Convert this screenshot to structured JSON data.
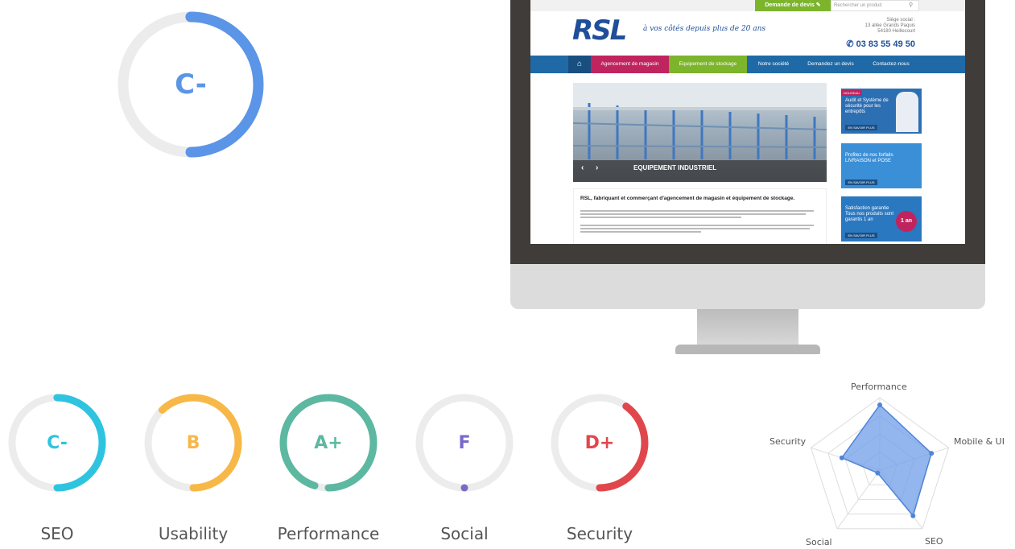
{
  "main_gauge": {
    "grade": "C-",
    "value": 0.5,
    "color": "#5b95e8"
  },
  "gauges": [
    {
      "label": "SEO",
      "grade": "C-",
      "value": 0.5,
      "color": "#2ec4e0"
    },
    {
      "label": "Usability",
      "grade": "B",
      "value": 0.62,
      "color": "#f7b847"
    },
    {
      "label": "Performance",
      "grade": "A+",
      "value": 0.95,
      "color": "#5cb8a0"
    },
    {
      "label": "Social",
      "grade": "F",
      "value": 0.0,
      "color": "#7b68c9"
    },
    {
      "label": "Security",
      "grade": "D+",
      "value": 0.4,
      "color": "#e0474c"
    }
  ],
  "website": {
    "quote_button": "Demande de devis",
    "search_placeholder": "Rechercher un produit",
    "logo": "RSL",
    "tagline": "à vos côtés depuis plus de 20 ans",
    "hq_title": "Siège social :",
    "hq_street": "13 allée Grands Paquis",
    "hq_city": "54180 Heillecourt",
    "phone": "03 83 55 49 50",
    "nav": [
      "Agencement de magasin",
      "Equipement de stockage",
      "Notre société",
      "Demandez un devis",
      "Contactez-nous"
    ],
    "slide_caption": "EQUIPEMENT INDUSTRIEL",
    "article_title": "RSL, fabriquant et commerçant d'agencement de magasin et équipement de stockage.",
    "promos": [
      {
        "badge": "NOUVEAU",
        "text": "Audit et Système de sécurité pour les entrepôts",
        "button": "EN SAVOIR PLUS"
      },
      {
        "text": "Profitez de nos forfaits LIVRAISON et POSE",
        "button": "EN SAVOIR PLUS"
      },
      {
        "text": "Satisfaction garantie Tous nos produits sont garantis 1 an",
        "badge": "1 an",
        "button": "EN SAVOIR PLUS"
      }
    ]
  },
  "radar": {
    "axes": [
      "Performance",
      "Mobile & UI",
      "SEO",
      "Social",
      "Security"
    ],
    "values": [
      0.9,
      0.75,
      0.78,
      0.05,
      0.55
    ],
    "fill": "#6f9ee8"
  }
}
